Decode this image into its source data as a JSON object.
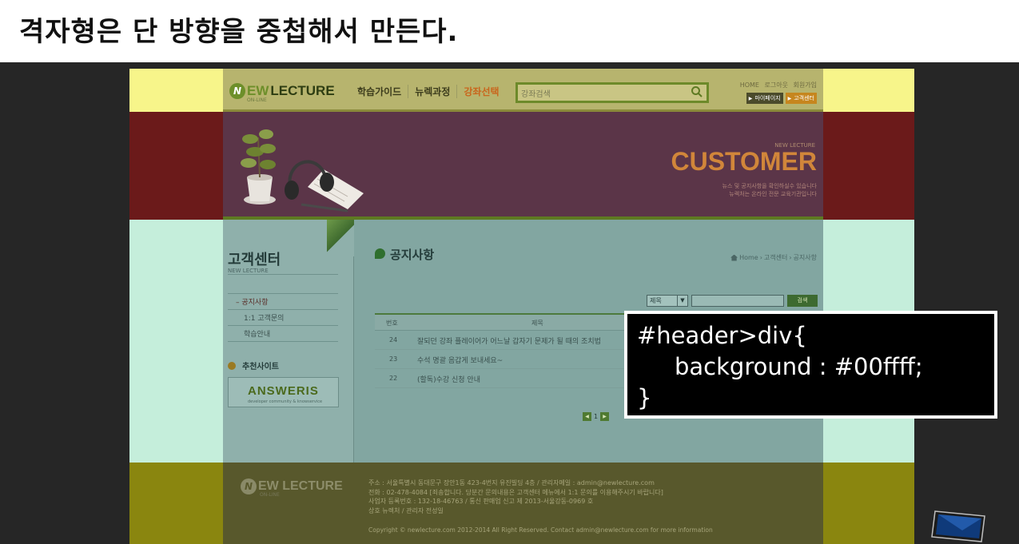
{
  "slide": {
    "title": "격자형은 단 방향을 중첩해서 만든다."
  },
  "site": {
    "header": {
      "logo_badge": "N",
      "logo_ew": "EW",
      "logo_lecture": "LECTURE",
      "logo_sub": "ON-LINE",
      "nav": [
        "학습가이드",
        "뉴렉과정",
        "강좌선택"
      ],
      "search_placeholder": "강좌검색",
      "util_links": [
        "HOME",
        "로그아웃",
        "회원가입"
      ],
      "mypage": "마이페이지",
      "customer_center": "고객센터"
    },
    "banner": {
      "small": "NEW LECTURE",
      "big": "CUSTOMER",
      "desc1": "뉴스 및 공지사항을 확인하실수 있습니다",
      "desc2": "뉴렉처는 온라인 전문 교육기관입니다"
    },
    "sidebar": {
      "title": "고객센터",
      "subtitle": "NEW LECTURE",
      "menu": [
        "공지사항",
        "1:1 고객문의",
        "학습안내"
      ],
      "recommend": "추천사이트",
      "answeris": "ANSWERIS",
      "answeris_sub": "developer community & knowservice"
    },
    "main": {
      "title": "공지사항",
      "breadcrumb": [
        "Home",
        "고객센터",
        "공지사항"
      ],
      "search_field": "제목",
      "search_button": "검색",
      "table_headers": {
        "no": "번호",
        "subject": "제목"
      },
      "rows": [
        {
          "no": "24",
          "subject": "잘되던 강좌 플레이어가 어느날 갑자기 문제가 될 때의 조치법"
        },
        {
          "no": "23",
          "subject": "수석 명괄 음갑게 보내세요~"
        },
        {
          "no": "22",
          "subject": "(할독)수강 신청 안내"
        }
      ],
      "page": "1"
    },
    "footer": {
      "logo_ew": "EW LECTURE",
      "logo_sub": "ON-LINE",
      "line1": "주소 : 서울특별시 동대문구 장안1동 423-4번지 유진빌딩 4층 /   관리자메일 : admin@newlecture.com",
      "line2": "전화 : 02-478-4084 [죄송합니다. 당분간 문의내용은 고객센터 메뉴에서 1:1 문의를 이용해주시기 바랍니다]",
      "line3": "사업자 등록번호 : 132-18-46763 / 통신 판매업 신고 제 2013-서울강동-0969 호",
      "line4": "상호 뉴렉처 / 관리자 전성일",
      "copyright": "Copyright © newlecture.com 2012-2014 All Right Reserved. Contact admin@newlecture.com for more information"
    }
  },
  "code": {
    "line1": "#header>div{",
    "line2": "background : #00ffff;",
    "line3": "}"
  },
  "colors": {
    "band_yellow": "#f7f58a",
    "band_red": "#6b1a1a",
    "band_cyan": "#c5eedb",
    "band_olive": "#8a860f"
  }
}
